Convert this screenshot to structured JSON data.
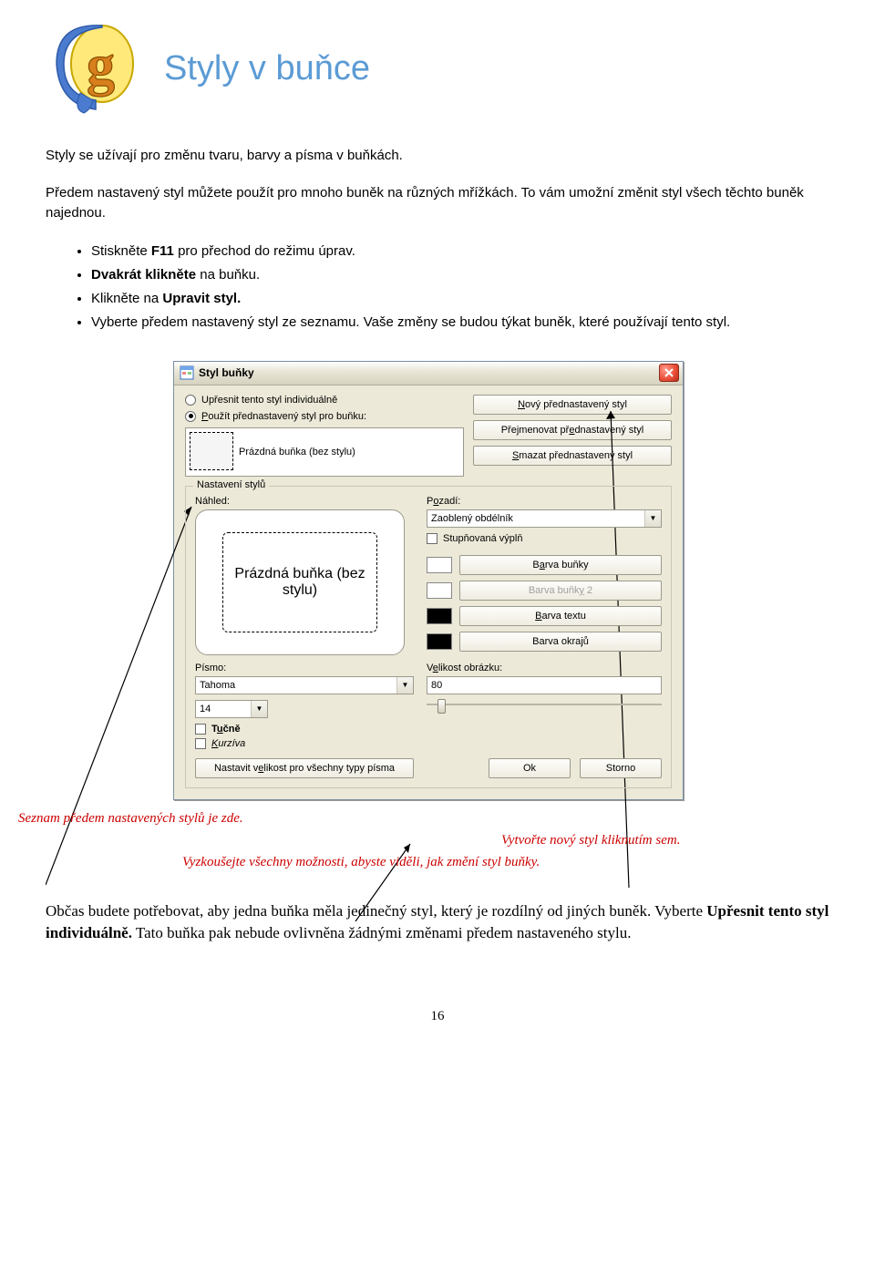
{
  "header": {
    "title": "Styly v buňce"
  },
  "intro": {
    "p1": "Styly se užívají pro změnu tvaru, barvy a písma v buňkách.",
    "p2": "Předem nastavený styl můžete použít pro mnoho buněk na různých mřížkách. To vám umožní změnit styl všech těchto buněk najednou."
  },
  "bullets": [
    {
      "pre": "Stiskněte ",
      "bold": "F11",
      "post": " pro přechod do režimu úprav."
    },
    {
      "pre": "",
      "bold": "Dvakrát klikněte",
      "post": "  na buňku."
    },
    {
      "pre": "Klikněte na  ",
      "bold": "Upravit styl.",
      "post": ""
    },
    {
      "pre": "Vyberte předem nastavený styl ze seznamu. Vaše změny se budou týkat buněk, které používají tento styl.",
      "bold": "",
      "post": ""
    }
  ],
  "dialog": {
    "title": "Styl buňky",
    "radio1": "Upřesnit tento styl individuálně",
    "radio2_u": "P",
    "radio2_rest": "oužít přednastavený styl pro buňku:",
    "btn_new_u": "N",
    "btn_new_rest": "ový přednastavený styl",
    "btn_ren1": "Přejmenovat př",
    "btn_ren_u": "e",
    "btn_ren2": "dnastavený styl",
    "btn_del_u": "S",
    "btn_del_rest": "mazat přednastavený styl",
    "list_text": "Prázdná buňka (bez stylu)",
    "legend": "Nastavení stylů",
    "lbl_preview": "Náhled:",
    "preview_text": "Prázdná buňka (bez stylu)",
    "lbl_font": "Písmo:",
    "font": "Tahoma",
    "fontsize": "14",
    "chk_bold1": "T",
    "chk_bold_u": "u",
    "chk_bold2": "čně",
    "chk_italic_u": "K",
    "chk_italic_rest": "urzíva",
    "lbl_bg1": "P",
    "lbl_bg_u": "o",
    "lbl_bg2": "zadí:",
    "bg_combo": "Zaoblený obdélník",
    "chk_grad": "Stupňovaná výplň",
    "btn_cellcolor1": "B",
    "btn_cellcolor_u": "a",
    "btn_cellcolor2": "rva buňky",
    "btn_cellcolor2_1": "Barva buňk",
    "btn_cellcolor2_u": "y",
    "btn_cellcolor2_2": " 2",
    "btn_textcolor_u": "B",
    "btn_textcolor_rest": "arva textu",
    "btn_bordercolor1": "Barva okra",
    "btn_bordercolor_u": "j",
    "btn_bordercolor2": "ů",
    "lbl_imgsize1": "V",
    "lbl_imgsize_u": "e",
    "lbl_imgsize2": "likost obrázku:",
    "imgsize": "80",
    "btn_setall1": "Nastavit v",
    "btn_setall_u": "e",
    "btn_setall2": "likost pro všechny typy písma",
    "btn_ok": "Ok",
    "btn_cancel": "Storno"
  },
  "captions": {
    "left": "Seznam předem nastavených stylů je zde.",
    "mid": "Vyzkoušejte všechny možnosti, abyste viděli, jak změní styl buňky.",
    "right": "Vytvořte nový styl kliknutím sem."
  },
  "final": {
    "t1": "Občas budete potřebovat, aby jedna buňka měla jedinečný styl, který je rozdílný od jiných buněk. Vyberte ",
    "b": "Upřesnit tento styl individuálně.",
    "t2": " Tato buňka pak nebude ovlivněna žádnými změnami předem nastaveného stylu."
  },
  "pagenum": "16"
}
